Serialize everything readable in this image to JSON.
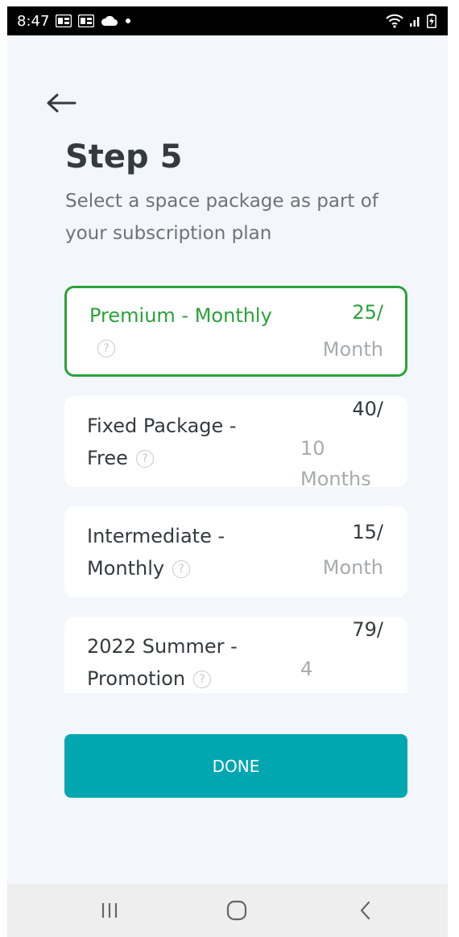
{
  "status_bar": {
    "time": "8:47",
    "left_icons": [
      "outlook-icon",
      "outlook-icon",
      "cloud-icon",
      "dot-icon"
    ],
    "right_icons": [
      "wifi-icon",
      "signal-icon",
      "battery-charging-icon"
    ]
  },
  "header": {
    "back_icon": "arrow-left-icon",
    "title": "Step 5",
    "subtitle": "Select a space package as part of your subscription plan"
  },
  "packages": [
    {
      "name": "Premium - Monthly",
      "price": "25/",
      "period": "Month",
      "selected": true
    },
    {
      "name": "Fixed Package - Free",
      "price": "40/",
      "period": "10 Months",
      "selected": false
    },
    {
      "name": "Intermediate - Monthly",
      "price": "15/",
      "period": "Month",
      "selected": false
    },
    {
      "name": "2022 Summer - Promotion",
      "price": "79/",
      "period": "4",
      "selected": false
    }
  ],
  "help_glyph": "?",
  "done_button": {
    "label": "DONE"
  },
  "nav_bar": {
    "icons": [
      "recent-apps-icon",
      "home-icon",
      "back-icon"
    ]
  },
  "colors": {
    "accent_green": "#2aa23a",
    "button_teal": "#00a6b0",
    "background": "#f3f7fb",
    "text_dark": "#343a40",
    "text_muted": "#a7abaf"
  }
}
